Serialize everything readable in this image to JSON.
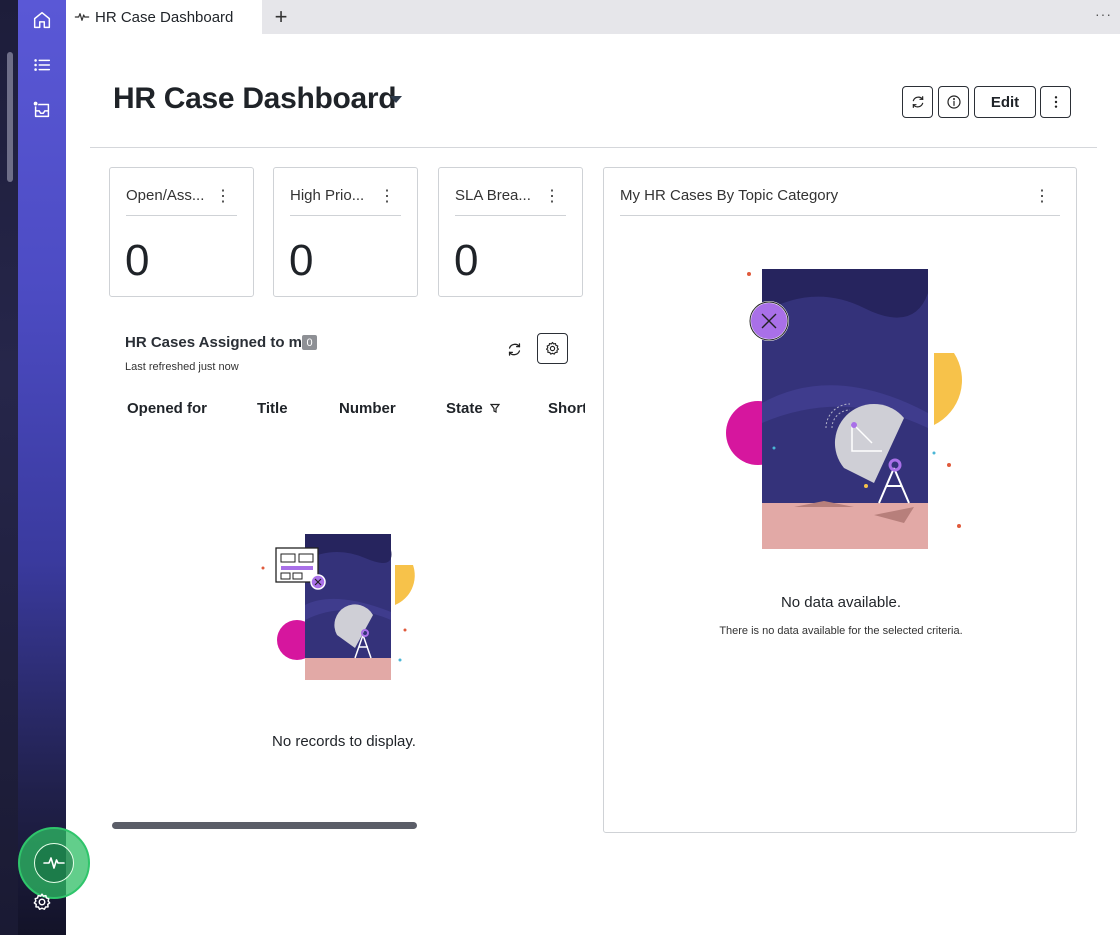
{
  "tabs": {
    "active_label": "HR Case Dashboard",
    "add_label": "+",
    "more_label": "···"
  },
  "header": {
    "title": "HR Case Dashboard",
    "edit_label": "Edit"
  },
  "metric_cards": [
    {
      "title": "Open/Ass...",
      "value": "0"
    },
    {
      "title": "High Prio...",
      "value": "0"
    },
    {
      "title": "SLA Brea...",
      "value": "0"
    }
  ],
  "list_widget": {
    "title": "HR Cases Assigned to me",
    "count": "0",
    "subtitle": "Last refreshed just now",
    "columns": [
      "Opened for",
      "Title",
      "Number",
      "State",
      "Short"
    ],
    "empty_message": "No records to display."
  },
  "topic_widget": {
    "title": "My HR Cases By Topic Category",
    "empty_title": "No data available.",
    "empty_subtitle": "There is no data available for the selected criteria."
  },
  "icons": {
    "sidebar": [
      "home-icon",
      "list-icon",
      "inbox-icon",
      "settings-icon"
    ],
    "header": [
      "refresh-icon",
      "info-icon",
      "more-vertical-icon"
    ],
    "pulse": "activity-pulse-icon"
  },
  "colors": {
    "sidebar_top": "#5a58d6",
    "sidebar_bottom": "#131328",
    "pulse_green": "#2fc56b",
    "illustration_navy": "#34327a",
    "illustration_magenta": "#d6169e",
    "illustration_yellow": "#f7c24a",
    "illustration_purple": "#a970e8"
  }
}
